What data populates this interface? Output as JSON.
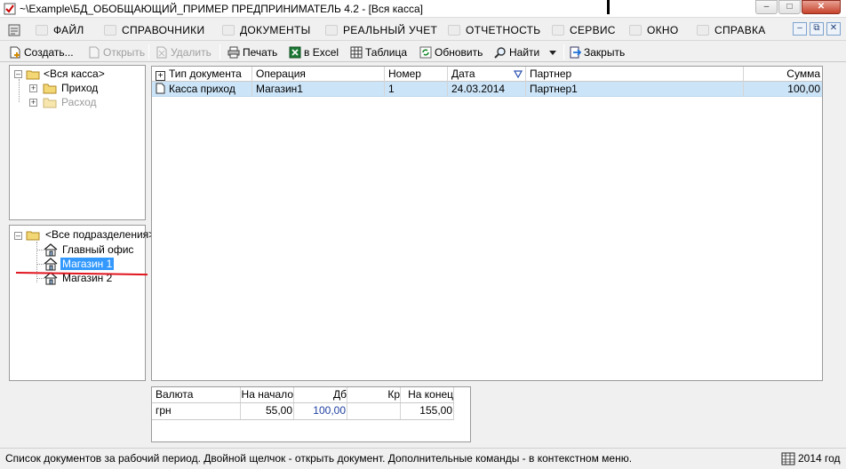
{
  "window": {
    "title": "~\\Example\\БД_ОБОБЩАЮЩИЙ_ПРИМЕР  ПРЕДПРИНИМАТЕЛЬ 4.2 - [Вся касса]"
  },
  "menu": {
    "items": [
      {
        "label": "ФАЙЛ"
      },
      {
        "label": "СПРАВОЧНИКИ"
      },
      {
        "label": "ДОКУМЕНТЫ"
      },
      {
        "label": "РЕАЛЬНЫЙ УЧЕТ"
      },
      {
        "label": "ОТЧЕТНОСТЬ"
      },
      {
        "label": "СЕРВИС"
      },
      {
        "label": "ОКНО"
      },
      {
        "label": "СПРАВКА"
      }
    ]
  },
  "toolbar": {
    "create": "Создать...",
    "open": "Открыть",
    "delete": "Удалить",
    "print": "Печать",
    "excel": "в Excel",
    "table": "Таблица",
    "refresh": "Обновить",
    "find": "Найти",
    "close": "Закрыть"
  },
  "cash_tree": {
    "root": "<Вся касса>",
    "children": [
      {
        "label": "Приход",
        "enabled": true
      },
      {
        "label": "Расход",
        "enabled": false
      }
    ]
  },
  "dept_tree": {
    "root": "<Все подразделения>",
    "children": [
      {
        "label": "Главный офис"
      },
      {
        "label": "Магазин 1",
        "selected": true
      },
      {
        "label": "Магазин 2"
      }
    ]
  },
  "grid": {
    "columns": [
      "Тип документа",
      "Операция",
      "Номер",
      "Дата",
      "Партнер",
      "Сумма"
    ],
    "rows": [
      {
        "type": "Касса приход",
        "operation": "Магазин1",
        "number": "1",
        "date": "24.03.2014",
        "partner": "Партнер1",
        "sum": "100,00"
      }
    ]
  },
  "balance": {
    "columns": [
      "Валюта",
      "На начало",
      "Дб",
      "Кр",
      "На конец"
    ],
    "rows": [
      {
        "currency": "грн",
        "start": "55,00",
        "debit": "100,00",
        "credit": "",
        "end": "155,00"
      }
    ]
  },
  "status": {
    "text": "Список документов за рабочий период. Двойной щелчок - открыть документ. Дополнительные команды - в контекстном меню.",
    "year": "2014 год"
  },
  "colors": {
    "selection_row": "#cce4f7",
    "selection_tree": "#3399ff",
    "annotation_line": "#e0141e",
    "debit_text": "#1f3fa0"
  }
}
